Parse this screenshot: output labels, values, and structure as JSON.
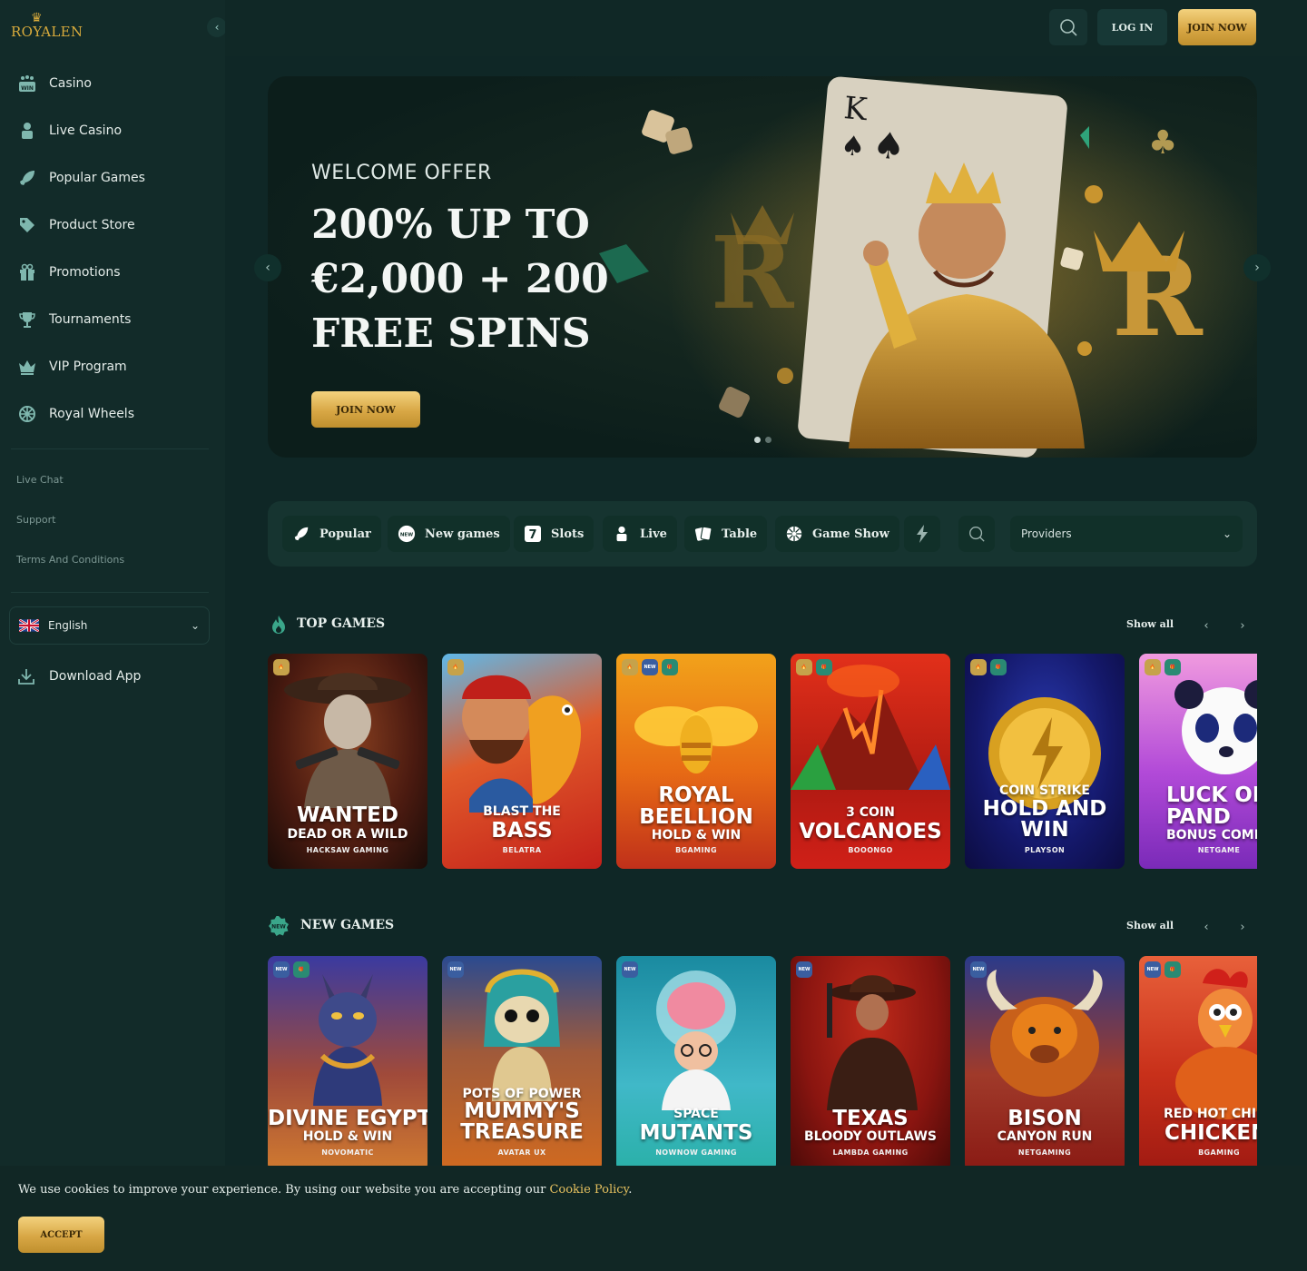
{
  "brand": {
    "logo_text": "ROYALEN"
  },
  "sidebar": {
    "items": [
      {
        "label": "Casino",
        "icon": "casino-icon"
      },
      {
        "label": "Live Casino",
        "icon": "dealer-icon"
      },
      {
        "label": "Popular Games",
        "icon": "rocket-icon"
      },
      {
        "label": "Product Store",
        "icon": "tag-icon"
      },
      {
        "label": "Promotions",
        "icon": "gift-icon"
      },
      {
        "label": "Tournaments",
        "icon": "trophy-icon"
      },
      {
        "label": "VIP Program",
        "icon": "crown-icon"
      },
      {
        "label": "Royal Wheels",
        "icon": "wheel-icon"
      }
    ],
    "links": [
      "Live Chat",
      "Support",
      "Terms And Conditions"
    ],
    "language": "English",
    "download": "Download App"
  },
  "header": {
    "login": "LOG IN",
    "join": "JOIN NOW"
  },
  "hero": {
    "kicker": "WELCOME OFFER",
    "line1": "200% UP TO",
    "line2": "€2,000 + 200",
    "line3": "FREE SPINS",
    "cta": "JOIN NOW",
    "slides": 2,
    "active_slide": 1
  },
  "filters": {
    "chips": [
      "Popular",
      "New games",
      "Slots",
      "Live",
      "Table",
      "Game Show"
    ],
    "providers": "Providers"
  },
  "top_games": {
    "title": "TOP GAMES",
    "show_all": "Show all",
    "cards": [
      {
        "sup": "",
        "l1": "WANTED",
        "l2": "DEAD OR A WILD",
        "provider": "HACKSAW GAMING",
        "badges": [
          "hot"
        ]
      },
      {
        "sup": "BLAST THE",
        "l1": "BASS",
        "l2": "",
        "provider": "BELATRA",
        "badges": [
          "hot"
        ]
      },
      {
        "sup": "",
        "l1": "ROYAL BEELLION",
        "l2": "HOLD & WIN",
        "provider": "BGAMING",
        "badges": [
          "hot",
          "new",
          "gift"
        ]
      },
      {
        "sup": "3 COIN",
        "l1": "VOLCANOES",
        "l2": "",
        "provider": "BOOONGO",
        "badges": [
          "hot",
          "gift"
        ]
      },
      {
        "sup": "COIN STRIKE",
        "l1": "HOLD AND WIN",
        "l2": "",
        "provider": "PLAYSON",
        "badges": [
          "hot",
          "gift"
        ]
      },
      {
        "sup": "",
        "l1": "LUCK OF PAND",
        "l2": "BONUS COME",
        "provider": "NETGAME",
        "badges": [
          "hot",
          "gift"
        ]
      }
    ]
  },
  "new_games": {
    "title": "NEW GAMES",
    "show_all": "Show all",
    "cards": [
      {
        "sup": "",
        "l1": "DIVINE EGYPT",
        "l2": "HOLD & WIN",
        "provider": "NOVOMATIC",
        "badges": [
          "new",
          "gift"
        ]
      },
      {
        "sup": "POTS OF POWER",
        "l1": "MUMMY'S TREASURE",
        "l2": "",
        "provider": "AVATAR UX",
        "badges": [
          "new"
        ]
      },
      {
        "sup": "SPACE",
        "l1": "MUTANTS",
        "l2": "",
        "provider": "NOWNOW GAMING",
        "badges": [
          "new"
        ]
      },
      {
        "sup": "",
        "l1": "TEXAS",
        "l2": "BLOODY OUTLAWS",
        "provider": "LAMBDA GAMING",
        "badges": [
          "new"
        ]
      },
      {
        "sup": "",
        "l1": "BISON",
        "l2": "CANYON RUN",
        "provider": "NETGAMING",
        "badges": [
          "new"
        ]
      },
      {
        "sup": "RED HOT CHIL",
        "l1": "CHICKEN",
        "l2": "",
        "provider": "BGAMING",
        "badges": [
          "new",
          "gift"
        ]
      }
    ]
  },
  "cookie": {
    "message": "We use cookies to improve your experience. By using our website you are accepting our",
    "link": "Cookie Policy",
    "period": ".",
    "accept": "ACCEPT"
  },
  "colors": {
    "gold": "#d8a745",
    "bg": "#0f2726",
    "panel": "#163430"
  }
}
